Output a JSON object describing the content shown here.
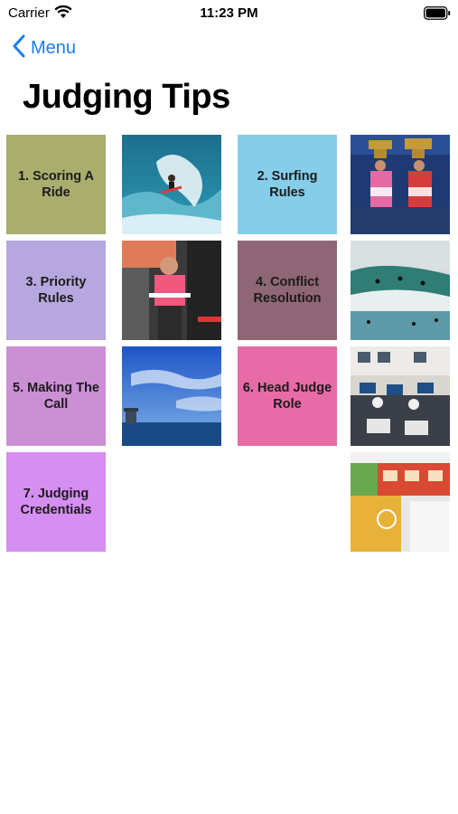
{
  "status_bar": {
    "carrier": "Carrier",
    "time": "11:23 PM"
  },
  "nav": {
    "back_label": "Menu",
    "back_icon": "chevron-left-icon"
  },
  "page": {
    "title": "Judging Tips"
  },
  "colors": {
    "accent": "#1a7cf1"
  },
  "tiles": [
    {
      "label": "1. Scoring A Ride",
      "color": "#a9ad6e"
    },
    {
      "label": "2. Surfing Rules",
      "color": "#86cde9"
    },
    {
      "label": "3. Priority Rules",
      "color": "#b7a7df"
    },
    {
      "label": "4. Conflict Resolution",
      "color": "#8e6676"
    },
    {
      "label": "5. Making The Call",
      "color": "#cb8fd4"
    },
    {
      "label": "6. Head Judge Role",
      "color": "#e66ba6"
    },
    {
      "label": "7. Judging Credentials",
      "color": "#d58ef1"
    }
  ],
  "photos": [
    {
      "name": "surfer-wave-photo"
    },
    {
      "name": "podium-trophies-photo"
    },
    {
      "name": "surfer-jersey-photo"
    },
    {
      "name": "lineup-surfers-photo"
    },
    {
      "name": "ocean-sky-photo"
    },
    {
      "name": "judging-room-photo"
    },
    {
      "name": "judging-tower-photo"
    }
  ]
}
